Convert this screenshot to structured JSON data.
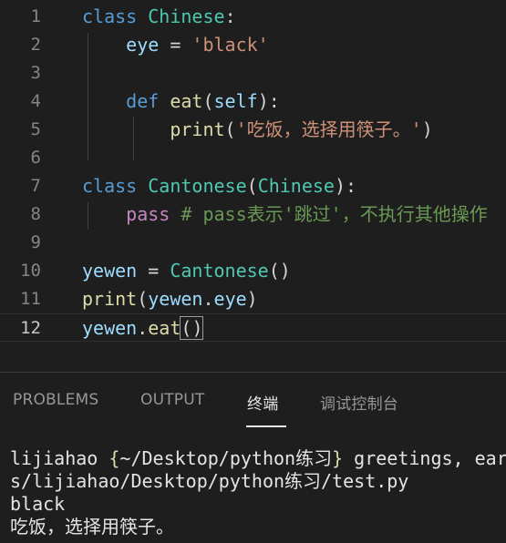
{
  "editor": {
    "line_numbers": [
      "1",
      "2",
      "3",
      "4",
      "5",
      "6",
      "7",
      "8",
      "9",
      "10",
      "11",
      "12"
    ],
    "active_line": "12",
    "l1": {
      "kw": "class",
      "cls": "Chinese",
      "colon": ":"
    },
    "l2": {
      "var": "eye",
      "eq": " = ",
      "str": "'black'"
    },
    "l4": {
      "kw": "def",
      "fn": "eat",
      "open": "(",
      "self": "self",
      "close": "):"
    },
    "l5": {
      "fn": "print",
      "open": "(",
      "str": "'吃饭，选择用筷子。'",
      "close": ")"
    },
    "l7": {
      "kw": "class",
      "cls": "Cantonese",
      "open": "(",
      "base": "Chinese",
      "close": "):"
    },
    "l8": {
      "ctrl": "pass",
      "cmt": " # pass表示'跳过'，不执行其他操作"
    },
    "l10": {
      "var": "yewen",
      "eq": " = ",
      "cls": "Cantonese",
      "call": "()"
    },
    "l11": {
      "fn": "print",
      "open": "(",
      "obj": "yewen",
      "dot": ".",
      "attr": "eye",
      "close": ")"
    },
    "l12": {
      "obj": "yewen",
      "dot": ".",
      "fn": "eat",
      "open": "(",
      "close": ")"
    }
  },
  "panel": {
    "tabs": [
      "PROBLEMS",
      "OUTPUT",
      "终端",
      "调试控制台"
    ],
    "active_tab": "终端"
  },
  "terminal": {
    "prompt_user": "lijiahao ",
    "prompt_open": "{",
    "prompt_path": "~/Desktop/python练习",
    "prompt_close": "}",
    "prompt_cmd": " greetings, ear",
    "line2": "s/lijiahao/Desktop/python练习/test.py",
    "line3": "black",
    "line4": "吃饭，选择用筷子。"
  }
}
